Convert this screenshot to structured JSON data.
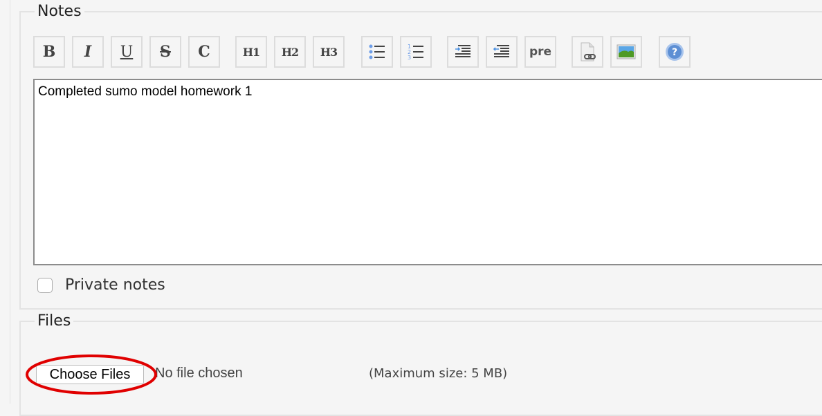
{
  "notes_section": {
    "legend": "Notes",
    "toolbar": [
      {
        "id": "bold",
        "label": "B",
        "icon": "bold-icon",
        "style": "italic:false"
      },
      {
        "id": "italic",
        "label": "I",
        "icon": "italic-icon"
      },
      {
        "id": "underline",
        "label": "U",
        "icon": "underline-icon"
      },
      {
        "id": "strikethrough",
        "label": "S",
        "icon": "strikethrough-icon"
      },
      {
        "id": "code",
        "label": "C",
        "icon": "code-icon"
      },
      {
        "id": "h1",
        "label": "H1",
        "icon": "heading-1-icon"
      },
      {
        "id": "h2",
        "label": "H2",
        "icon": "heading-2-icon"
      },
      {
        "id": "h3",
        "label": "H3",
        "icon": "heading-3-icon"
      },
      {
        "id": "ul",
        "label": "",
        "icon": "bulleted-list-icon"
      },
      {
        "id": "ol",
        "label": "",
        "icon": "numbered-list-icon"
      },
      {
        "id": "indent",
        "label": "",
        "icon": "indent-icon"
      },
      {
        "id": "outdent",
        "label": "",
        "icon": "outdent-icon"
      },
      {
        "id": "pre",
        "label": "pre",
        "icon": "preformatted-icon"
      },
      {
        "id": "link",
        "label": "",
        "icon": "link-file-icon"
      },
      {
        "id": "image",
        "label": "",
        "icon": "image-icon"
      },
      {
        "id": "help",
        "label": "",
        "icon": "help-icon"
      }
    ],
    "content": "Completed sumo model homework 1",
    "private_label": "Private notes",
    "private_checked": false
  },
  "files_section": {
    "legend": "Files",
    "choose_button": "Choose Files",
    "no_file_text": "No file chosen",
    "max_size_text": "(Maximum size: 5 MB)"
  },
  "annotation": {
    "highlight_color": "#e00000"
  }
}
